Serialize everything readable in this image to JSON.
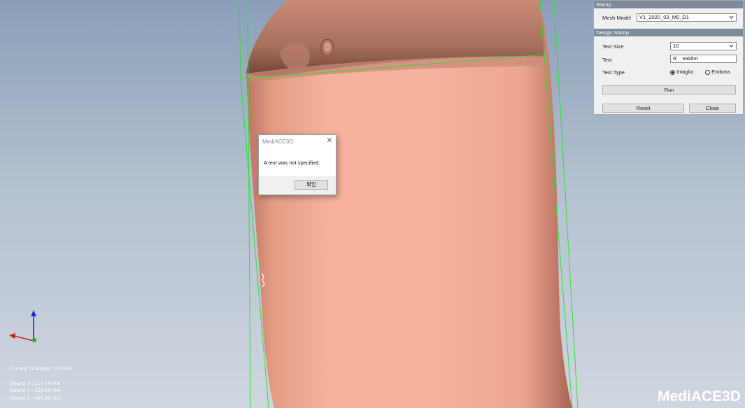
{
  "panel": {
    "title": "Stamp",
    "mesh_model_label": "Mesh Model",
    "mesh_model_value": "V1_2020_03_M0_D1",
    "section_title": "Design Stamp",
    "text_size_label": "Text Size",
    "text_size_value": "10",
    "text_label": "Text",
    "text_value": "R    ealdim",
    "text_type_label": "Text Type",
    "intaglio_label": "Intaglio",
    "emboss_label": "Emboss",
    "run_label": "Run",
    "reset_label": "Reset",
    "close_label": "Close"
  },
  "dialog": {
    "title": "MediACE3D",
    "message": "A text was not specified.",
    "ok_label": "확인"
  },
  "info": {
    "triangles": "- Current Triangles : 231434",
    "bound_x": "- Bound X : 117.74 mm",
    "bound_y": "- Bound Y : 254.38 mm",
    "bound_z": "- Bound Z : 409.86 mm"
  },
  "logo": "MediACE3D",
  "colors": {
    "mesh": "#f2ad97",
    "bbox": "#2ee02e",
    "panel_header": "#7d8a9a"
  }
}
